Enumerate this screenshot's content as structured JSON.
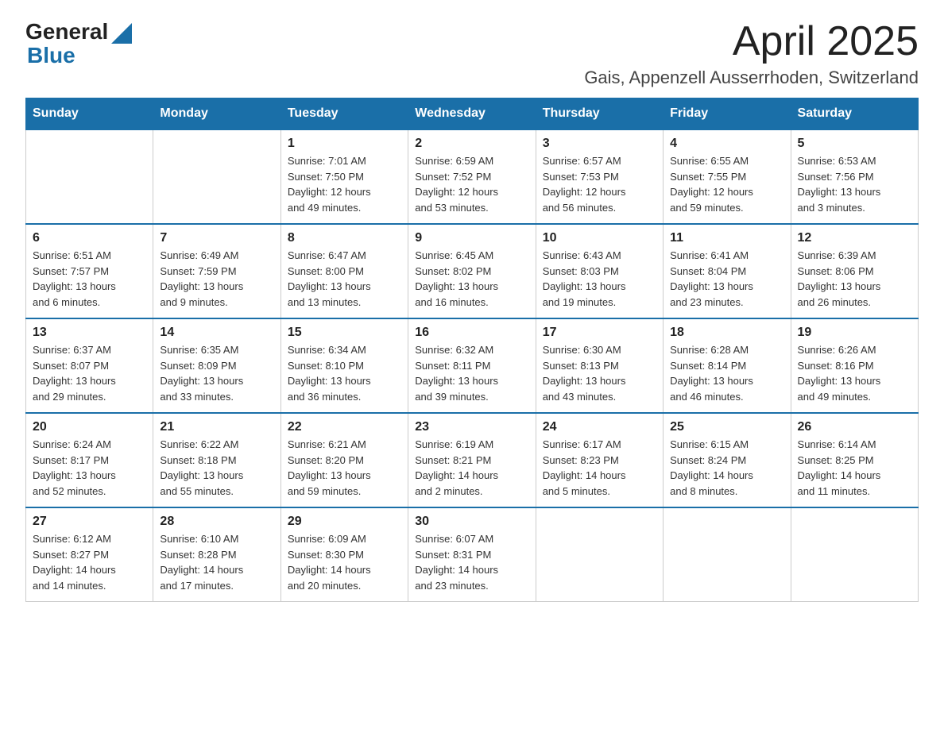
{
  "logo": {
    "text_general": "General",
    "text_blue": "Blue"
  },
  "header": {
    "title": "April 2025",
    "subtitle": "Gais, Appenzell Ausserrhoden, Switzerland"
  },
  "weekdays": [
    "Sunday",
    "Monday",
    "Tuesday",
    "Wednesday",
    "Thursday",
    "Friday",
    "Saturday"
  ],
  "weeks": [
    [
      {
        "day": "",
        "info": ""
      },
      {
        "day": "",
        "info": ""
      },
      {
        "day": "1",
        "info": "Sunrise: 7:01 AM\nSunset: 7:50 PM\nDaylight: 12 hours\nand 49 minutes."
      },
      {
        "day": "2",
        "info": "Sunrise: 6:59 AM\nSunset: 7:52 PM\nDaylight: 12 hours\nand 53 minutes."
      },
      {
        "day": "3",
        "info": "Sunrise: 6:57 AM\nSunset: 7:53 PM\nDaylight: 12 hours\nand 56 minutes."
      },
      {
        "day": "4",
        "info": "Sunrise: 6:55 AM\nSunset: 7:55 PM\nDaylight: 12 hours\nand 59 minutes."
      },
      {
        "day": "5",
        "info": "Sunrise: 6:53 AM\nSunset: 7:56 PM\nDaylight: 13 hours\nand 3 minutes."
      }
    ],
    [
      {
        "day": "6",
        "info": "Sunrise: 6:51 AM\nSunset: 7:57 PM\nDaylight: 13 hours\nand 6 minutes."
      },
      {
        "day": "7",
        "info": "Sunrise: 6:49 AM\nSunset: 7:59 PM\nDaylight: 13 hours\nand 9 minutes."
      },
      {
        "day": "8",
        "info": "Sunrise: 6:47 AM\nSunset: 8:00 PM\nDaylight: 13 hours\nand 13 minutes."
      },
      {
        "day": "9",
        "info": "Sunrise: 6:45 AM\nSunset: 8:02 PM\nDaylight: 13 hours\nand 16 minutes."
      },
      {
        "day": "10",
        "info": "Sunrise: 6:43 AM\nSunset: 8:03 PM\nDaylight: 13 hours\nand 19 minutes."
      },
      {
        "day": "11",
        "info": "Sunrise: 6:41 AM\nSunset: 8:04 PM\nDaylight: 13 hours\nand 23 minutes."
      },
      {
        "day": "12",
        "info": "Sunrise: 6:39 AM\nSunset: 8:06 PM\nDaylight: 13 hours\nand 26 minutes."
      }
    ],
    [
      {
        "day": "13",
        "info": "Sunrise: 6:37 AM\nSunset: 8:07 PM\nDaylight: 13 hours\nand 29 minutes."
      },
      {
        "day": "14",
        "info": "Sunrise: 6:35 AM\nSunset: 8:09 PM\nDaylight: 13 hours\nand 33 minutes."
      },
      {
        "day": "15",
        "info": "Sunrise: 6:34 AM\nSunset: 8:10 PM\nDaylight: 13 hours\nand 36 minutes."
      },
      {
        "day": "16",
        "info": "Sunrise: 6:32 AM\nSunset: 8:11 PM\nDaylight: 13 hours\nand 39 minutes."
      },
      {
        "day": "17",
        "info": "Sunrise: 6:30 AM\nSunset: 8:13 PM\nDaylight: 13 hours\nand 43 minutes."
      },
      {
        "day": "18",
        "info": "Sunrise: 6:28 AM\nSunset: 8:14 PM\nDaylight: 13 hours\nand 46 minutes."
      },
      {
        "day": "19",
        "info": "Sunrise: 6:26 AM\nSunset: 8:16 PM\nDaylight: 13 hours\nand 49 minutes."
      }
    ],
    [
      {
        "day": "20",
        "info": "Sunrise: 6:24 AM\nSunset: 8:17 PM\nDaylight: 13 hours\nand 52 minutes."
      },
      {
        "day": "21",
        "info": "Sunrise: 6:22 AM\nSunset: 8:18 PM\nDaylight: 13 hours\nand 55 minutes."
      },
      {
        "day": "22",
        "info": "Sunrise: 6:21 AM\nSunset: 8:20 PM\nDaylight: 13 hours\nand 59 minutes."
      },
      {
        "day": "23",
        "info": "Sunrise: 6:19 AM\nSunset: 8:21 PM\nDaylight: 14 hours\nand 2 minutes."
      },
      {
        "day": "24",
        "info": "Sunrise: 6:17 AM\nSunset: 8:23 PM\nDaylight: 14 hours\nand 5 minutes."
      },
      {
        "day": "25",
        "info": "Sunrise: 6:15 AM\nSunset: 8:24 PM\nDaylight: 14 hours\nand 8 minutes."
      },
      {
        "day": "26",
        "info": "Sunrise: 6:14 AM\nSunset: 8:25 PM\nDaylight: 14 hours\nand 11 minutes."
      }
    ],
    [
      {
        "day": "27",
        "info": "Sunrise: 6:12 AM\nSunset: 8:27 PM\nDaylight: 14 hours\nand 14 minutes."
      },
      {
        "day": "28",
        "info": "Sunrise: 6:10 AM\nSunset: 8:28 PM\nDaylight: 14 hours\nand 17 minutes."
      },
      {
        "day": "29",
        "info": "Sunrise: 6:09 AM\nSunset: 8:30 PM\nDaylight: 14 hours\nand 20 minutes."
      },
      {
        "day": "30",
        "info": "Sunrise: 6:07 AM\nSunset: 8:31 PM\nDaylight: 14 hours\nand 23 minutes."
      },
      {
        "day": "",
        "info": ""
      },
      {
        "day": "",
        "info": ""
      },
      {
        "day": "",
        "info": ""
      }
    ]
  ]
}
